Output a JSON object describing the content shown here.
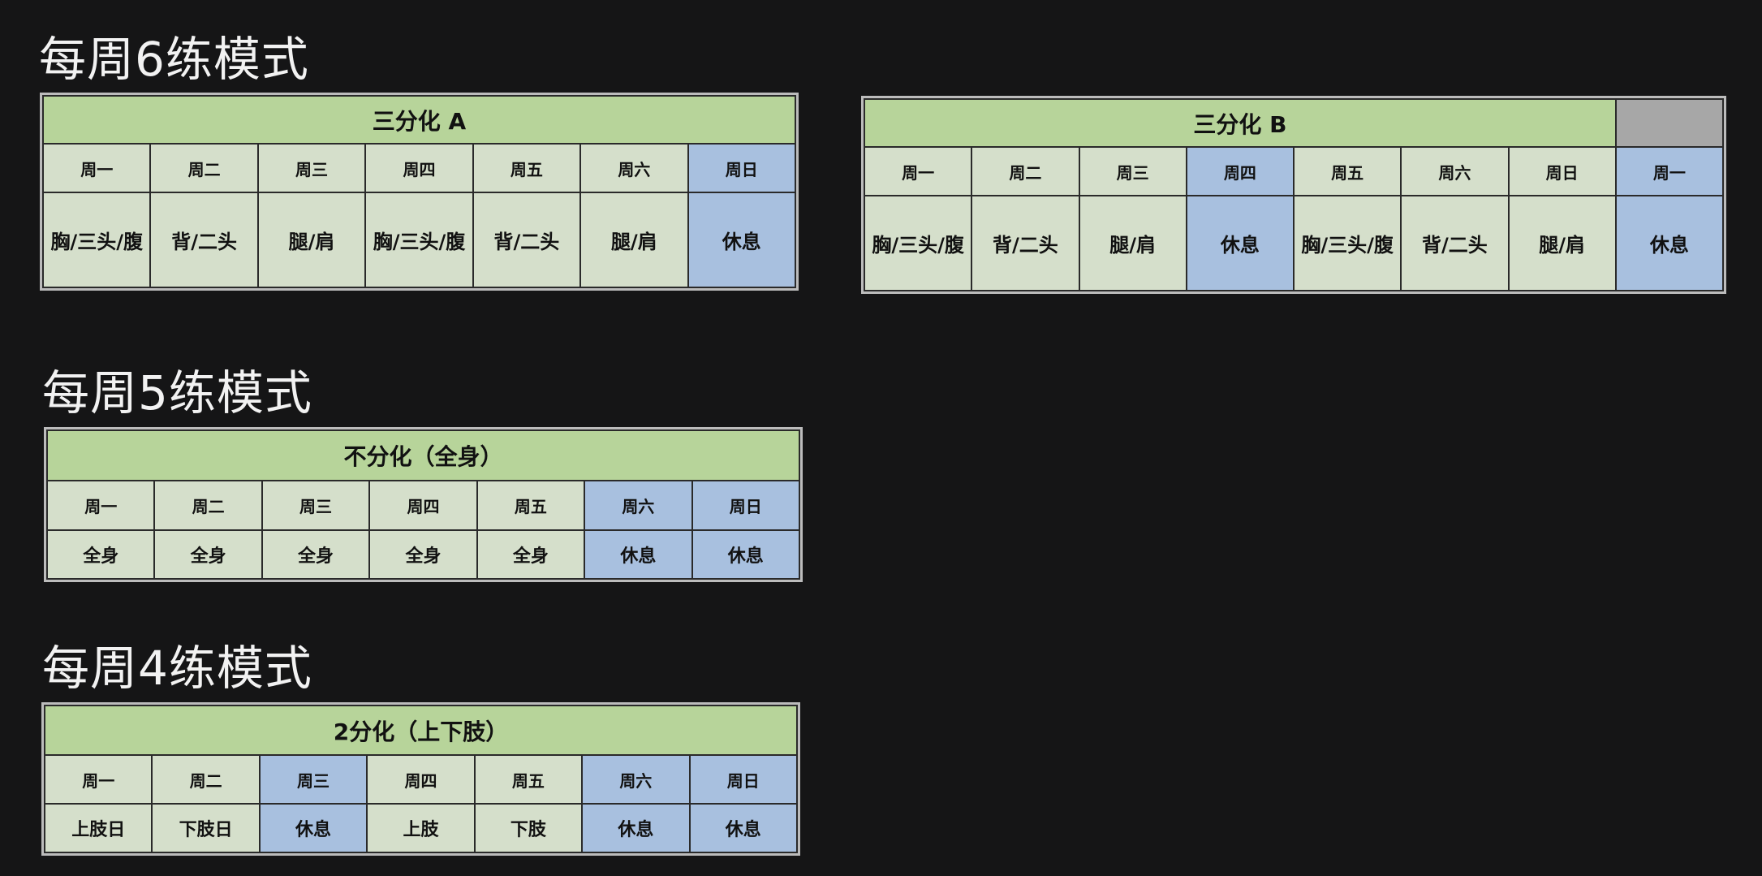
{
  "sections": [
    {
      "title": "每周6练模式",
      "tables": [
        {
          "header": "三分化 A",
          "days": [
            "周一",
            "周二",
            "周三",
            "周四",
            "周五",
            "周六",
            "周日"
          ],
          "plan": [
            "胸/三头/腹",
            "背/二头",
            "腿/肩",
            "胸/三头/腹",
            "背/二头",
            "腿/肩",
            "休息"
          ]
        },
        {
          "header": "三分化 B",
          "days": [
            "周一",
            "周二",
            "周三",
            "周四",
            "周五",
            "周六",
            "周日",
            "周一"
          ],
          "plan": [
            "胸/三头/腹",
            "背/二头",
            "腿/肩",
            "休息",
            "胸/三头/腹",
            "背/二头",
            "腿/肩",
            "休息"
          ]
        }
      ]
    },
    {
      "title": "每周5练模式",
      "tables": [
        {
          "header": "不分化（全身）",
          "days": [
            "周一",
            "周二",
            "周三",
            "周四",
            "周五",
            "周六",
            "周日"
          ],
          "plan": [
            "全身",
            "全身",
            "全身",
            "全身",
            "全身",
            "休息",
            "休息"
          ]
        }
      ]
    },
    {
      "title": "每周4练模式",
      "tables": [
        {
          "header": "2分化（上下肢）",
          "days": [
            "周一",
            "周二",
            "周三",
            "周四",
            "周五",
            "周六",
            "周日"
          ],
          "plan": [
            "上肢日",
            "下肢日",
            "休息",
            "上肢",
            "下肢",
            "休息",
            "休息"
          ]
        }
      ]
    }
  ],
  "colors": {
    "background": "#151516",
    "header_green": "#b7d49a",
    "training_day": "#d5dfcb",
    "rest_day": "#a8c0df"
  }
}
